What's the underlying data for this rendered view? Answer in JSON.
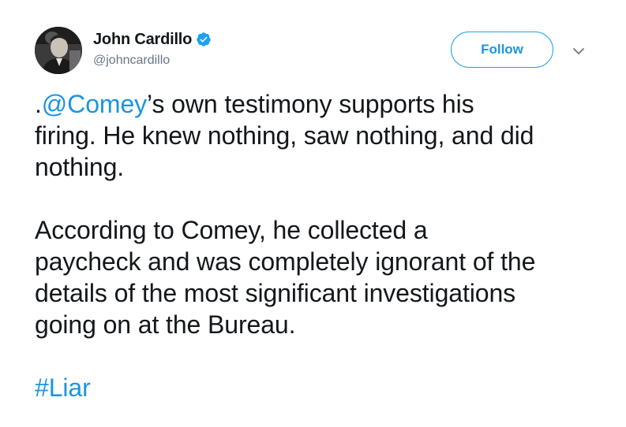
{
  "author": {
    "display_name": "John Cardillo",
    "handle": "@johncardillo",
    "verified": true,
    "verified_icon": "verified-badge-icon",
    "avatar_icon": "user-avatar"
  },
  "actions": {
    "follow_label": "Follow",
    "more_icon": "chevron-down-icon"
  },
  "tweet": {
    "p1_prefix": ".",
    "p1_mention": "@Comey",
    "p1_rest_line1": "’s own testimony supports his",
    "p1_line2": "firing. He knew nothing, saw nothing, and did",
    "p1_line3": "nothing.",
    "p2_line1": "According to Comey, he collected a",
    "p2_line2": "paycheck and was completely ignorant of the",
    "p2_line3": "details of the most significant investigations",
    "p2_line4": "going on at the Bureau.",
    "hashtag": "#Liar"
  },
  "colors": {
    "link": "#1b95e0",
    "text": "#14171a",
    "secondary": "#657786",
    "follow_border": "#1da1f2"
  }
}
